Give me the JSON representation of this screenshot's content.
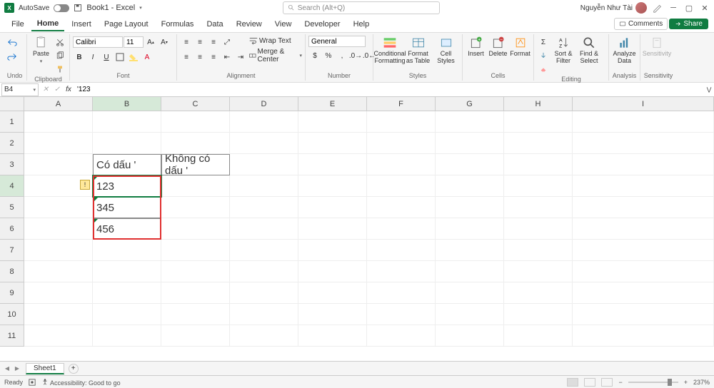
{
  "titlebar": {
    "autosave_label": "AutoSave",
    "autosave_state": "Off",
    "doc_title": "Book1 - Excel",
    "search_placeholder": "Search (Alt+Q)",
    "user_name": "Nguyễn Như Tài"
  },
  "menu": {
    "file": "File",
    "tabs": [
      "Home",
      "Insert",
      "Page Layout",
      "Formulas",
      "Data",
      "Review",
      "View",
      "Developer",
      "Help"
    ],
    "active_tab": "Home",
    "comments": "Comments",
    "share": "Share"
  },
  "ribbon": {
    "undo": "Undo",
    "clipboard": "Clipboard",
    "paste": "Paste",
    "font_group": "Font",
    "font_name": "Calibri",
    "font_size": "11",
    "alignment": "Alignment",
    "wrap_text": "Wrap Text",
    "merge_center": "Merge & Center",
    "number_group": "Number",
    "number_format": "General",
    "styles": "Styles",
    "cond_fmt": "Conditional Formatting",
    "fmt_table": "Format as Table",
    "cell_styles": "Cell Styles",
    "cells_group": "Cells",
    "insert": "Insert",
    "delete": "Delete",
    "format": "Format",
    "editing": "Editing",
    "sort_filter": "Sort & Filter",
    "find_select": "Find & Select",
    "analysis": "Analysis",
    "analyze_data": "Analyze Data",
    "sensitivity_group": "Sensitivity",
    "sensitivity": "Sensitivity"
  },
  "formula_bar": {
    "name_box": "B4",
    "formula": "'123"
  },
  "columns": [
    "A",
    "B",
    "C",
    "D",
    "E",
    "F",
    "G",
    "H",
    "I"
  ],
  "rows": [
    "1",
    "2",
    "3",
    "4",
    "5",
    "6",
    "7",
    "8",
    "9",
    "10",
    "11"
  ],
  "active_col": "B",
  "active_row": "4",
  "cell_data": {
    "B3": "Có dấu '",
    "C3": "Không có dấu '",
    "B4": "123",
    "B5": "345",
    "B6": "456"
  },
  "sheet": {
    "name": "Sheet1"
  },
  "status": {
    "ready": "Ready",
    "accessibility": "Accessibility: Good to go",
    "zoom": "237%"
  }
}
